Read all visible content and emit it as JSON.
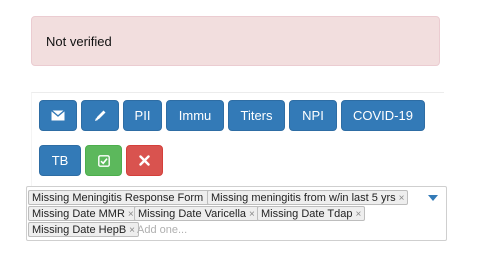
{
  "alert": {
    "text": "Not verified"
  },
  "buttons": {
    "pii": "PII",
    "immu": "Immu",
    "titers": "Titers",
    "npi": "NPI",
    "covid": "COVID-19",
    "tb": "TB"
  },
  "icons": {
    "email": "envelope-icon",
    "edit": "pencil-icon",
    "verify": "check-square-icon",
    "remove": "x-icon"
  },
  "colors": {
    "primary": "#337ab7",
    "success": "#5cb85c",
    "danger": "#d9534f",
    "alert_bg": "#f2dede"
  },
  "tags": [
    "Missing Meningitis Response Form",
    "Missing meningitis from w/in last 5 yrs",
    "Missing Date MMR",
    "Missing Date Varicella",
    "Missing Date Tdap",
    "Missing Date HepB"
  ],
  "tag_remove": "×",
  "tag_placeholder": "Add one..."
}
